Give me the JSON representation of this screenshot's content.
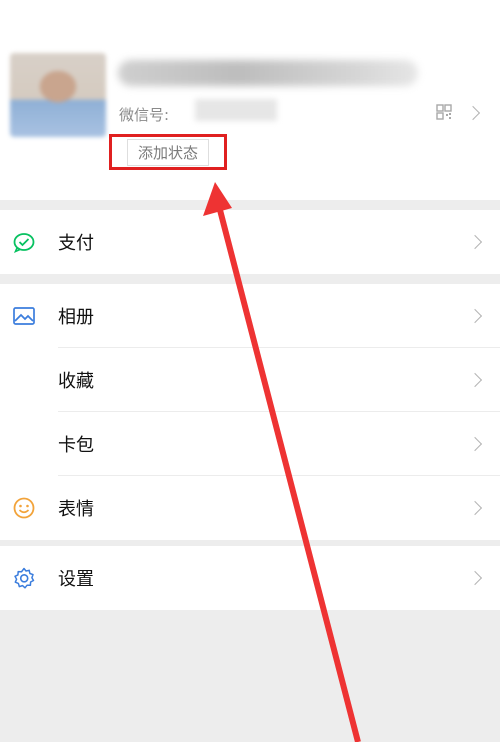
{
  "profile": {
    "wechat_id_label": "微信号:",
    "status_button": "添加状态"
  },
  "menu": {
    "pay": {
      "label": "支付",
      "icon": "wechat-pay-icon"
    },
    "album": {
      "label": "相册",
      "icon": "album-icon"
    },
    "favorites": {
      "label": "收藏"
    },
    "cards": {
      "label": "卡包"
    },
    "stickers": {
      "label": "表情",
      "icon": "smiley-icon"
    },
    "settings": {
      "label": "设置",
      "icon": "gear-icon"
    }
  },
  "colors": {
    "highlight": "#e02020",
    "pay_green": "#07c160",
    "icon_blue": "#3b7ddd",
    "smiley_orange": "#f2a33a"
  }
}
